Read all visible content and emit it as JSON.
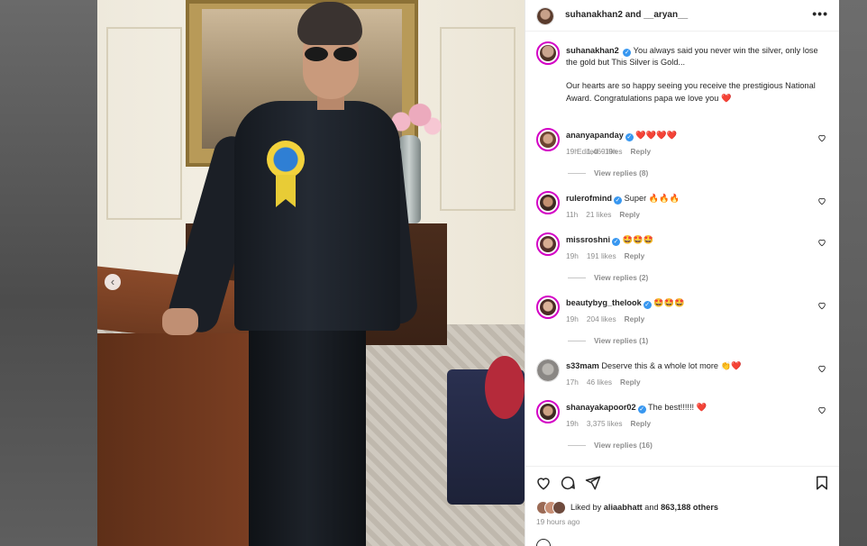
{
  "post": {
    "header": {
      "title": "suhanakhan2 and __aryan__",
      "more": "•••"
    },
    "caption": {
      "username": "suhanakhan2",
      "verified_mark": "✓",
      "line1": "You always said you never win the silver, only lose the gold but This Silver is Gold...",
      "line2": "Our hearts are so happy seeing you receive the prestigious National Award. Congratulations papa we love you ❤️",
      "meta": "Edited · 19h"
    },
    "comments": [
      {
        "username": "ananyapanday",
        "verified": true,
        "text": "❤️❤️❤️❤️",
        "time": "19h",
        "likes": "1,469 likes",
        "reply": "Reply",
        "view_replies": "View replies (8)"
      },
      {
        "username": "rulerofmind",
        "verified": true,
        "text": "Super 🔥🔥🔥",
        "time": "11h",
        "likes": "21 likes",
        "reply": "Reply",
        "view_replies": ""
      },
      {
        "username": "missroshni",
        "verified": true,
        "text": "🤩🤩🤩",
        "time": "19h",
        "likes": "191 likes",
        "reply": "Reply",
        "view_replies": "View replies (2)"
      },
      {
        "username": "beautybyg_thelook",
        "verified": true,
        "text": "🤩🤩🤩",
        "time": "19h",
        "likes": "204 likes",
        "reply": "Reply",
        "view_replies": "View replies (1)"
      },
      {
        "username": "s33mam",
        "verified": false,
        "text": "Deserve this & a whole lot more 👏❤️",
        "time": "17h",
        "likes": "46 likes",
        "reply": "Reply",
        "view_replies": ""
      },
      {
        "username": "shanayakapoor02",
        "verified": true,
        "text": "The best!!!!!! ❤️",
        "time": "19h",
        "likes": "3,375 likes",
        "reply": "Reply",
        "view_replies": "View replies (16)"
      }
    ],
    "likes": {
      "prefix": "Liked by",
      "liker": "aliaabhatt",
      "joiner": "and",
      "others": "863,188 others"
    },
    "time_ago": "19 hours ago",
    "carousel_prev": "‹"
  },
  "colors": {
    "verified": "#3897f0",
    "story_ring": "#d300c5",
    "heart": "#ed4956"
  },
  "icons": [
    "heart-icon",
    "comment-icon",
    "share-icon",
    "bookmark-icon",
    "more-icon",
    "verified-icon",
    "chevron-left-icon"
  ]
}
